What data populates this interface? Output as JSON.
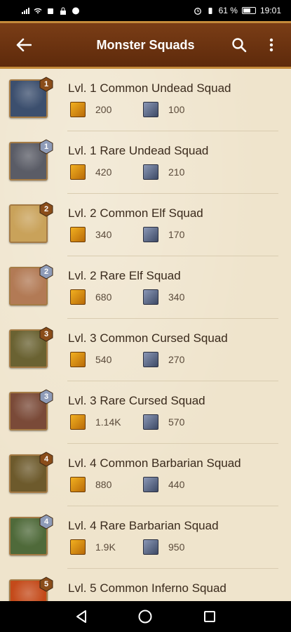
{
  "status_bar": {
    "battery": "61 %",
    "time": "19:01"
  },
  "app_bar": {
    "title": "Monster Squads"
  },
  "colors": {
    "app_bar": "#6a3210",
    "background": "#efe4cc",
    "badge_common": "#8a4d1a",
    "badge_rare": "#8e9bb8"
  },
  "squads": [
    {
      "name": "Lvl. 1 Common Undead Squad",
      "level": "1",
      "rarity": "common",
      "food": "200",
      "stone": "100",
      "portrait_color": "#3c4f6e"
    },
    {
      "name": "Lvl. 1 Rare Undead Squad",
      "level": "1",
      "rarity": "rare",
      "food": "420",
      "stone": "210",
      "portrait_color": "#5a5c66"
    },
    {
      "name": "Lvl. 2 Common Elf Squad",
      "level": "2",
      "rarity": "common",
      "food": "340",
      "stone": "170",
      "portrait_color": "#c9a25a"
    },
    {
      "name": "Lvl. 2 Rare Elf Squad",
      "level": "2",
      "rarity": "rare",
      "food": "680",
      "stone": "340",
      "portrait_color": "#b27a55"
    },
    {
      "name": "Lvl. 3 Common Cursed Squad",
      "level": "3",
      "rarity": "common",
      "food": "540",
      "stone": "270",
      "portrait_color": "#6a6232"
    },
    {
      "name": "Lvl. 3 Rare Cursed Squad",
      "level": "3",
      "rarity": "rare",
      "food": "1.14K",
      "stone": "570",
      "portrait_color": "#7a4a38"
    },
    {
      "name": "Lvl. 4 Common Barbarian Squad",
      "level": "4",
      "rarity": "common",
      "food": "880",
      "stone": "440",
      "portrait_color": "#6d5a2c"
    },
    {
      "name": "Lvl. 4 Rare Barbarian Squad",
      "level": "4",
      "rarity": "rare",
      "food": "1.9K",
      "stone": "950",
      "portrait_color": "#4f6a3a"
    },
    {
      "name": "Lvl. 5 Common Inferno Squad",
      "level": "5",
      "rarity": "common",
      "food": "",
      "stone": "",
      "portrait_color": "#c44a1a"
    }
  ]
}
